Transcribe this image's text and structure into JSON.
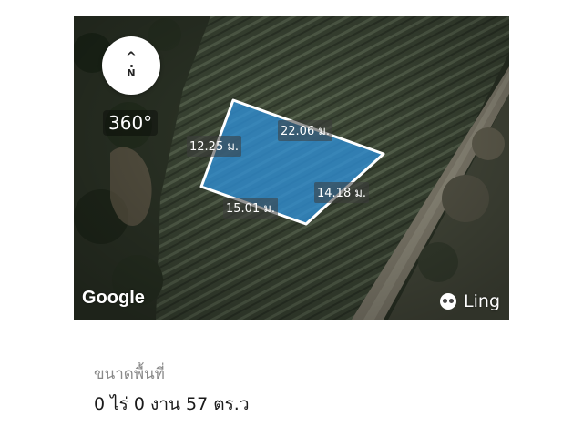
{
  "map": {
    "compass": {
      "arrow": "^",
      "north": "N"
    },
    "heading": "360°",
    "dimensions": {
      "top": "22.06 ม.",
      "left": "12.25 ม.",
      "right": "14.18 ม.",
      "bottom": "15.01 ม."
    },
    "attribution": "Google",
    "brand": "Ling",
    "colors": {
      "plot_fill": "#2f8fd6",
      "plot_outline": "#ffffff"
    }
  },
  "info": {
    "label": "ขนาดพื้นที่",
    "value": "0 ไร่ 0 งาน 57 ตร.ว"
  }
}
